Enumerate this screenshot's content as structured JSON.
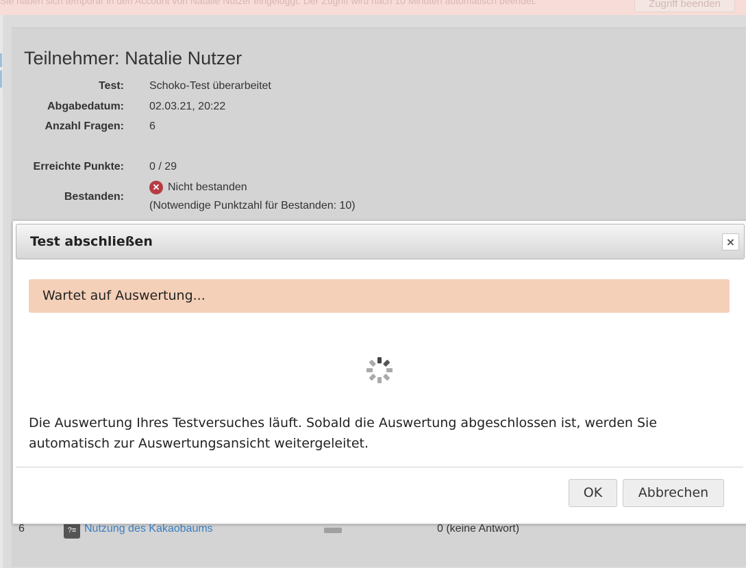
{
  "impersonation_bar": {
    "message": "Sie haben sich temporär in den Account von Natalie Nutzer eingeloggt. Der Zugriff wird nach 10 Minuten automatisch beendet.",
    "end_button": "Zugriff beenden"
  },
  "participant": {
    "title": "Teilnehmer: Natalie Nutzer",
    "fields": [
      {
        "label": "Test:",
        "value": "Schoko-Test überarbeitet"
      },
      {
        "label": "Abgabedatum:",
        "value": "02.03.21, 20:22"
      },
      {
        "label": "Anzahl Fragen:",
        "value": "6"
      },
      {
        "label": "Erreichte Punkte:",
        "value": "0 / 29"
      },
      {
        "label": "Bestanden:",
        "value": "Nicht bestanden",
        "note": "(Notwendige Punktzahl für Bestanden: 10)"
      }
    ]
  },
  "question_row": {
    "number": "6",
    "title": "Nutzung des Kakaobaums",
    "result": "0 (keine Antwort)"
  },
  "dialog": {
    "title": "Test abschließen",
    "close_symbol": "×",
    "alert": "Wartet auf Auswertung...",
    "text": "Die Auswertung Ihres Testversuches läuft. Sobald die Auswertung abgeschlossen ist, werden Sie automatisch zur Auswertungsansicht weitergeleitet.",
    "ok_label": "OK",
    "cancel_label": "Abbrechen"
  },
  "colors": {
    "alert_bg": "#f5d0b8",
    "fail_icon": "#b73b43",
    "link": "#3a7ec0"
  },
  "icons": [
    "close-icon",
    "fail-x-icon",
    "loading-spinner-icon",
    "question-icon"
  ]
}
